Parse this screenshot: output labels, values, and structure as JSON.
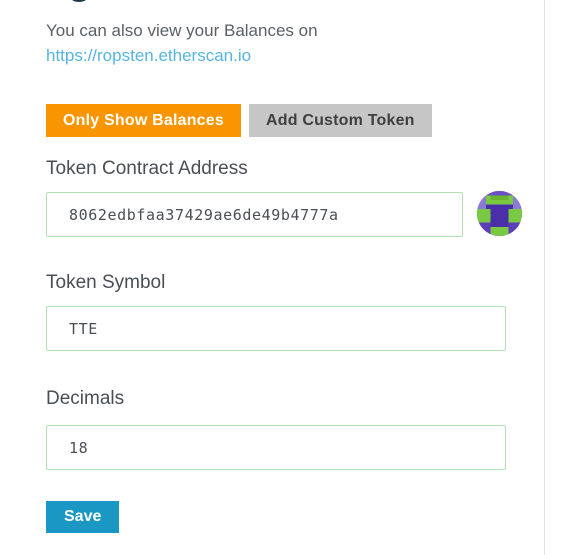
{
  "intro": {
    "text": "You can also view your Balances on",
    "link": "https://ropsten.etherscan.io"
  },
  "tabs": [
    {
      "label": "Only Show Balances",
      "state": "active"
    },
    {
      "label": "Add Custom Token",
      "state": "inactive"
    }
  ],
  "form": {
    "address": {
      "label": "Token Contract Address",
      "value": "8062edbfaa37429ae6de49b4777a",
      "placeholder": "Token Contract Address"
    },
    "symbol": {
      "label": "Token Symbol",
      "value": "TTE",
      "placeholder": "Token Symbol"
    },
    "decimals": {
      "label": "Decimals",
      "value": "18",
      "placeholder": "Decimals"
    }
  },
  "save": {
    "label": "Save"
  },
  "identicon": {
    "name": "token-identicon",
    "colors": {
      "background": "#6b4fc4",
      "accent": "#7ac943",
      "shade": "#8b7ad6"
    }
  },
  "colors": {
    "accent_orange": "#f99500",
    "accent_blue": "#1b97c4",
    "link_blue": "#56b4e0",
    "input_border_green": "#b3e0b3",
    "inactive_grey": "#c6c6c6",
    "text_grey": "#5b6066"
  }
}
